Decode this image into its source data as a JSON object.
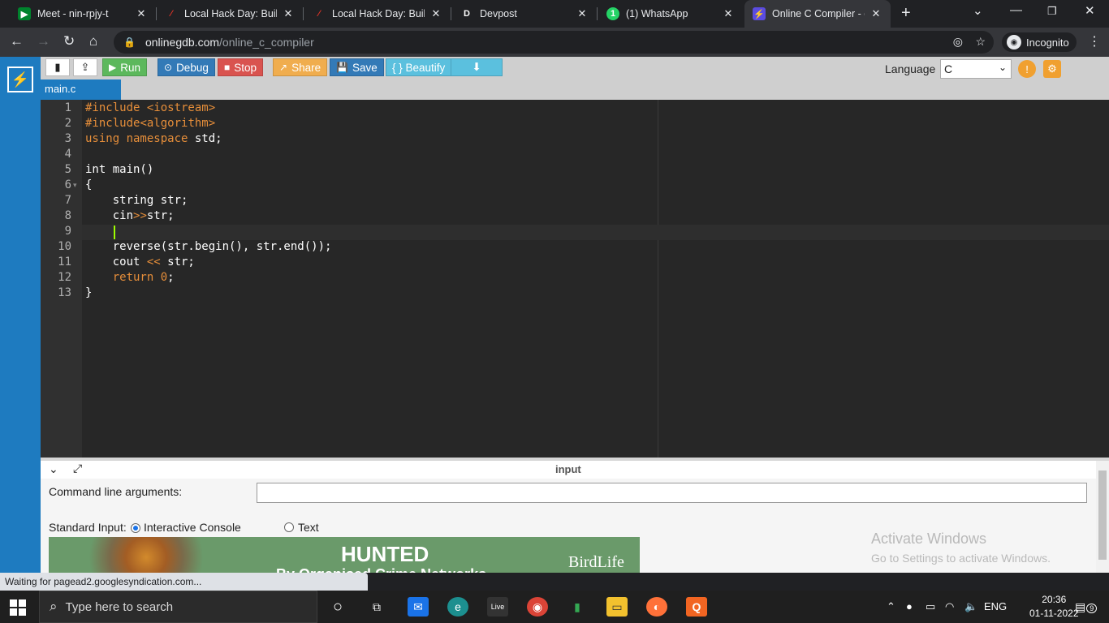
{
  "browser": {
    "tabs": [
      {
        "title": "Meet - nin-rpjy-t",
        "icon": "meet-icon",
        "active": false
      },
      {
        "title": "Local Hack Day: Build",
        "icon": "mlh-icon",
        "active": false
      },
      {
        "title": "Local Hack Day: Build",
        "icon": "mlh-icon",
        "active": false
      },
      {
        "title": "Devpost",
        "icon": "devpost-icon",
        "active": false
      },
      {
        "title": "(1) WhatsApp",
        "icon": "whatsapp-icon",
        "active": false
      },
      {
        "title": "Online C Compiler - o",
        "icon": "onlinegdb-icon",
        "active": true
      }
    ],
    "url_domain": "onlinegdb.com",
    "url_path": "/online_c_compiler",
    "profile_label": "Incognito",
    "status_text": "Waiting for pagead2.googlesyndication.com..."
  },
  "toolbar": {
    "run_label": "Run",
    "debug_label": "Debug",
    "stop_label": "Stop",
    "share_label": "Share",
    "save_label": "Save",
    "beautify_label": "{ } Beautify",
    "language_label": "Language",
    "language_value": "C",
    "colors": {
      "run": "#5cb85c",
      "debug": "#337ab7",
      "stop": "#d9534f",
      "share": "#f0ad4e",
      "save": "#337ab7",
      "beautify": "#5bc0de",
      "download": "#5bc0de"
    }
  },
  "editor": {
    "file_tab": "main.c",
    "lines": [
      {
        "n": "1",
        "segments": [
          {
            "t": "#include ",
            "c": "inc"
          },
          {
            "t": "<iostream>",
            "c": "inc"
          }
        ]
      },
      {
        "n": "2",
        "segments": [
          {
            "t": "#include",
            "c": "inc"
          },
          {
            "t": "<algorithm>",
            "c": "inc"
          }
        ]
      },
      {
        "n": "3",
        "segments": [
          {
            "t": "using namespace",
            "c": "kw"
          },
          {
            "t": " std;",
            "c": ""
          }
        ]
      },
      {
        "n": "4",
        "segments": []
      },
      {
        "n": "5",
        "segments": [
          {
            "t": "int main()",
            "c": ""
          }
        ]
      },
      {
        "n": "6",
        "segments": [
          {
            "t": "{",
            "c": ""
          }
        ],
        "fold": true
      },
      {
        "n": "7",
        "segments": [
          {
            "t": "    string str;",
            "c": ""
          }
        ]
      },
      {
        "n": "8",
        "segments": [
          {
            "t": "    cin",
            "c": ""
          },
          {
            "t": ">>",
            "c": "op"
          },
          {
            "t": "str;",
            "c": ""
          }
        ]
      },
      {
        "n": "9",
        "segments": [],
        "cursor": true
      },
      {
        "n": "10",
        "segments": [
          {
            "t": "    reverse(str.begin(), str.end());",
            "c": ""
          }
        ]
      },
      {
        "n": "11",
        "segments": [
          {
            "t": "    cout ",
            "c": ""
          },
          {
            "t": "<<",
            "c": "op"
          },
          {
            "t": " str;",
            "c": ""
          }
        ]
      },
      {
        "n": "12",
        "segments": [
          {
            "t": "    ",
            "c": ""
          },
          {
            "t": "return",
            "c": "kw"
          },
          {
            "t": " ",
            "c": ""
          },
          {
            "t": "0",
            "c": "num"
          },
          {
            "t": ";",
            "c": ""
          }
        ]
      },
      {
        "n": "13",
        "segments": [
          {
            "t": "}",
            "c": ""
          }
        ]
      }
    ]
  },
  "input_panel": {
    "title": "input",
    "cmd_label": "Command line arguments:",
    "cmd_value": "",
    "stdin_label": "Standard Input:",
    "opt_interactive": "Interactive Console",
    "opt_text": "Text",
    "selected": "Interactive Console"
  },
  "ad": {
    "headline": "HUNTED",
    "subline": "By Organised Crime Networks",
    "brand": "BirdLife"
  },
  "watermark": {
    "line1": "Activate Windows",
    "line2": "Go to Settings to activate Windows."
  },
  "taskbar": {
    "search_placeholder": "Type here to search",
    "language": "ENG",
    "time": "20:36",
    "date": "01-11-2022",
    "notification_count": "9"
  }
}
